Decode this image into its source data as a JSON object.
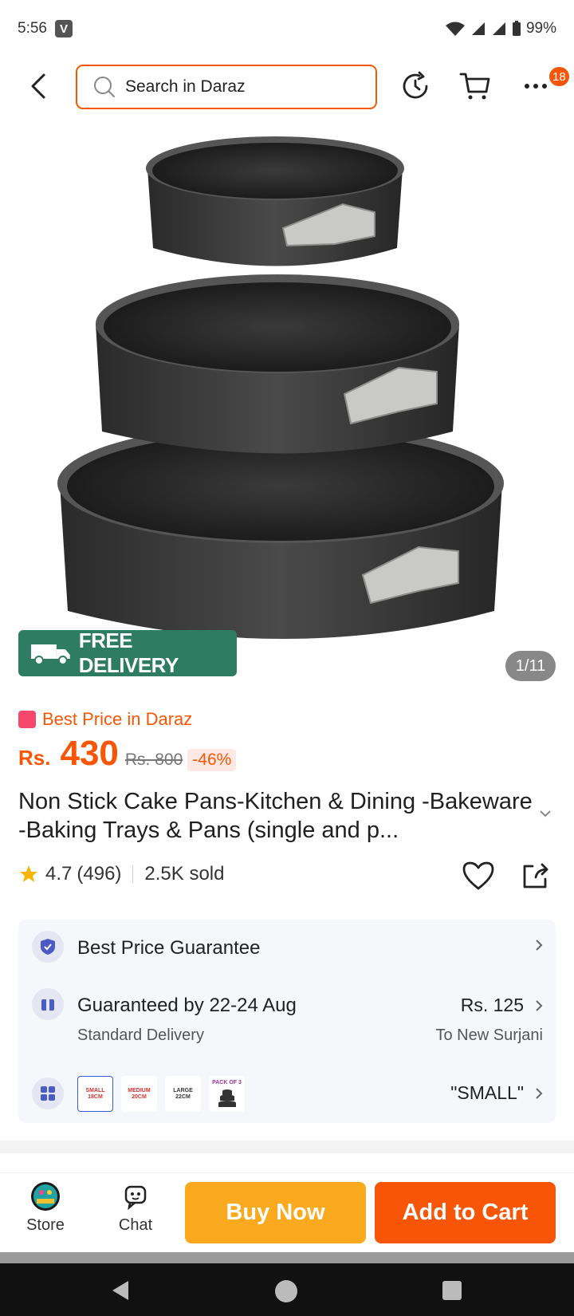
{
  "status_bar": {
    "time": "5:56",
    "app_badge": "V",
    "battery": "99%"
  },
  "header": {
    "search_placeholder": "Search in Daraz",
    "more_badge": "18"
  },
  "product": {
    "free_delivery_label": "FREE DELIVERY",
    "free_tag": "FREE",
    "image_counter": "1/11",
    "best_price_label": "Best Price in Daraz",
    "currency": "Rs.",
    "price": "430",
    "old_price": "Rs. 800",
    "discount": "-46%",
    "title": "Non Stick Cake Pans-Kitchen & Dining -Bakeware -Baking Trays & Pans (single and p...",
    "rating": "4.7",
    "reviews": "(496)",
    "sold": "2.5K sold"
  },
  "info_card": {
    "guarantee_label": "Best Price Guarantee",
    "delivery_label": "Guaranteed by 22-24 Aug",
    "delivery_type": "Standard Delivery",
    "delivery_price": "Rs. 125",
    "delivery_location": "To New Surjani",
    "selected_variant": "\"SMALL\"",
    "variants": [
      {
        "line1": "SMALL",
        "line2": "18CM"
      },
      {
        "line1": "MEDIUM",
        "line2": "20CM"
      },
      {
        "line1": "LARGE",
        "line2": "22CM"
      },
      {
        "line1": "PACK OF 3",
        "line2": ""
      }
    ]
  },
  "bottom_bar": {
    "store_label": "Store",
    "chat_label": "Chat",
    "buy_now_label": "Buy Now",
    "add_to_cart_label": "Add to Cart"
  },
  "colors": {
    "accent": "#f85606",
    "buy_now": "#fba91f",
    "free_delivery": "#2e7d62"
  }
}
